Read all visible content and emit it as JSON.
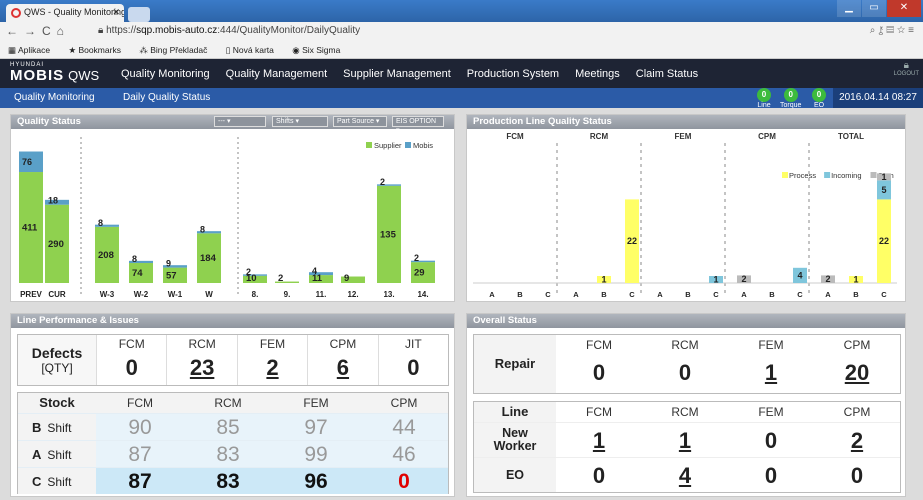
{
  "browser": {
    "tab_title": "QWS - Quality Monitoring",
    "url_prefix": "https://",
    "url_host": "sqp.mobis-auto.cz",
    "url_path": ":444/QualityMonitor/DailyQuality",
    "bookmarks": [
      "Aplikace",
      "Bookmarks",
      "Bing Překladač",
      "Nová karta",
      "Six Sigma"
    ]
  },
  "app": {
    "logo_small": "HYUNDAI",
    "logo_brand": "MOBIS",
    "logo_app": "QWS",
    "menu": [
      "Quality Monitoring",
      "Quality Management",
      "Supplier Management",
      "Production System",
      "Meetings",
      "Claim Status"
    ],
    "logout": "LOGOUT",
    "breadcrumb": [
      "Quality Monitoring",
      "Daily Quality Status"
    ],
    "indicators": [
      {
        "value": "0",
        "label": "Line"
      },
      {
        "value": "0",
        "label": "Torque"
      },
      {
        "value": "0",
        "label": "EO"
      }
    ],
    "datetime": "2016.04.14 08:27"
  },
  "quality_status": {
    "title": "Quality Status",
    "filters": [
      "---",
      "Shifts",
      "Part Source",
      "EIS OPTION"
    ]
  },
  "chart_data": [
    {
      "type": "bar",
      "stacked": true,
      "title": "Quality Status",
      "categories": [
        "PREV",
        "CUR",
        "W-3",
        "W-2",
        "W-1",
        "W",
        "8.",
        "9.",
        "11.",
        "12.",
        "13.",
        "14."
      ],
      "series": [
        {
          "name": "Supplier",
          "color": "#8fd14f",
          "values": [
            411,
            290,
            208,
            74,
            57,
            184,
            10,
            2,
            11,
            9,
            135,
            29
          ]
        },
        {
          "name": "Mobis",
          "color": "#5aa0c8",
          "values": [
            76,
            18,
            8,
            8,
            9,
            8,
            2,
            0,
            4,
            0,
            2,
            2
          ]
        }
      ],
      "legend": "top-right"
    },
    {
      "type": "bar",
      "stacked": true,
      "title": "Production Line Quality Status",
      "groups": [
        "FCM",
        "RCM",
        "FEM",
        "CPM",
        "TOTAL"
      ],
      "categories": [
        "A",
        "B",
        "C",
        "A",
        "B",
        "C",
        "A",
        "B",
        "C",
        "A",
        "B",
        "C",
        "A",
        "B",
        "C"
      ],
      "series": [
        {
          "name": "Process",
          "color": "#ffff66",
          "values": [
            0,
            0,
            0,
            0,
            1,
            22,
            0,
            0,
            0,
            0,
            0,
            0,
            0,
            1,
            22
          ]
        },
        {
          "name": "Incoming",
          "color": "#7fc6dc",
          "values": [
            0,
            0,
            0,
            0,
            0,
            0,
            0,
            0,
            1,
            0,
            0,
            4,
            0,
            0,
            5
          ]
        },
        {
          "name": "Oem",
          "color": "#bbbbbb",
          "values": [
            0,
            0,
            0,
            0,
            0,
            0,
            0,
            0,
            0,
            2,
            0,
            0,
            2,
            0,
            1
          ]
        }
      ],
      "legend": "top-right"
    }
  ],
  "production_line": {
    "title": "Production Line Quality Status"
  },
  "line_performance": {
    "title": "Line Performance & Issues",
    "defects": {
      "label": "Defects",
      "sublabel": "[QTY]",
      "columns": [
        "FCM",
        "RCM",
        "FEM",
        "CPM",
        "JIT"
      ],
      "values": [
        "0",
        "23",
        "2",
        "6",
        "0"
      ]
    },
    "stock": {
      "label": "Stock",
      "columns": [
        "FCM",
        "RCM",
        "FEM",
        "CPM"
      ],
      "rows": [
        {
          "shift": "B",
          "label": "Shift",
          "values": [
            "90",
            "85",
            "97",
            "44"
          ]
        },
        {
          "shift": "A",
          "label": "Shift",
          "values": [
            "87",
            "83",
            "99",
            "46"
          ]
        },
        {
          "shift": "C",
          "label": "Shift",
          "values": [
            "87",
            "83",
            "96",
            "0"
          ]
        }
      ]
    }
  },
  "overall": {
    "title": "Overall Status",
    "repair": {
      "label": "Repair",
      "columns": [
        "FCM",
        "RCM",
        "FEM",
        "CPM"
      ],
      "values": [
        "0",
        "0",
        "1",
        "20"
      ]
    },
    "line": {
      "label": "Line",
      "columns": [
        "FCM",
        "RCM",
        "FEM",
        "CPM"
      ],
      "rows": [
        {
          "label": "New Worker",
          "values": [
            "1",
            "1",
            "0",
            "2"
          ]
        },
        {
          "label": "EO",
          "values": [
            "0",
            "4",
            "0",
            "0"
          ]
        }
      ]
    }
  },
  "colors": {
    "header": "#1e2434",
    "subbar": "#2b5ba7",
    "panel_title": "#9aa0a8",
    "indicator": "#3dbb3d",
    "alert": "#e00000"
  }
}
